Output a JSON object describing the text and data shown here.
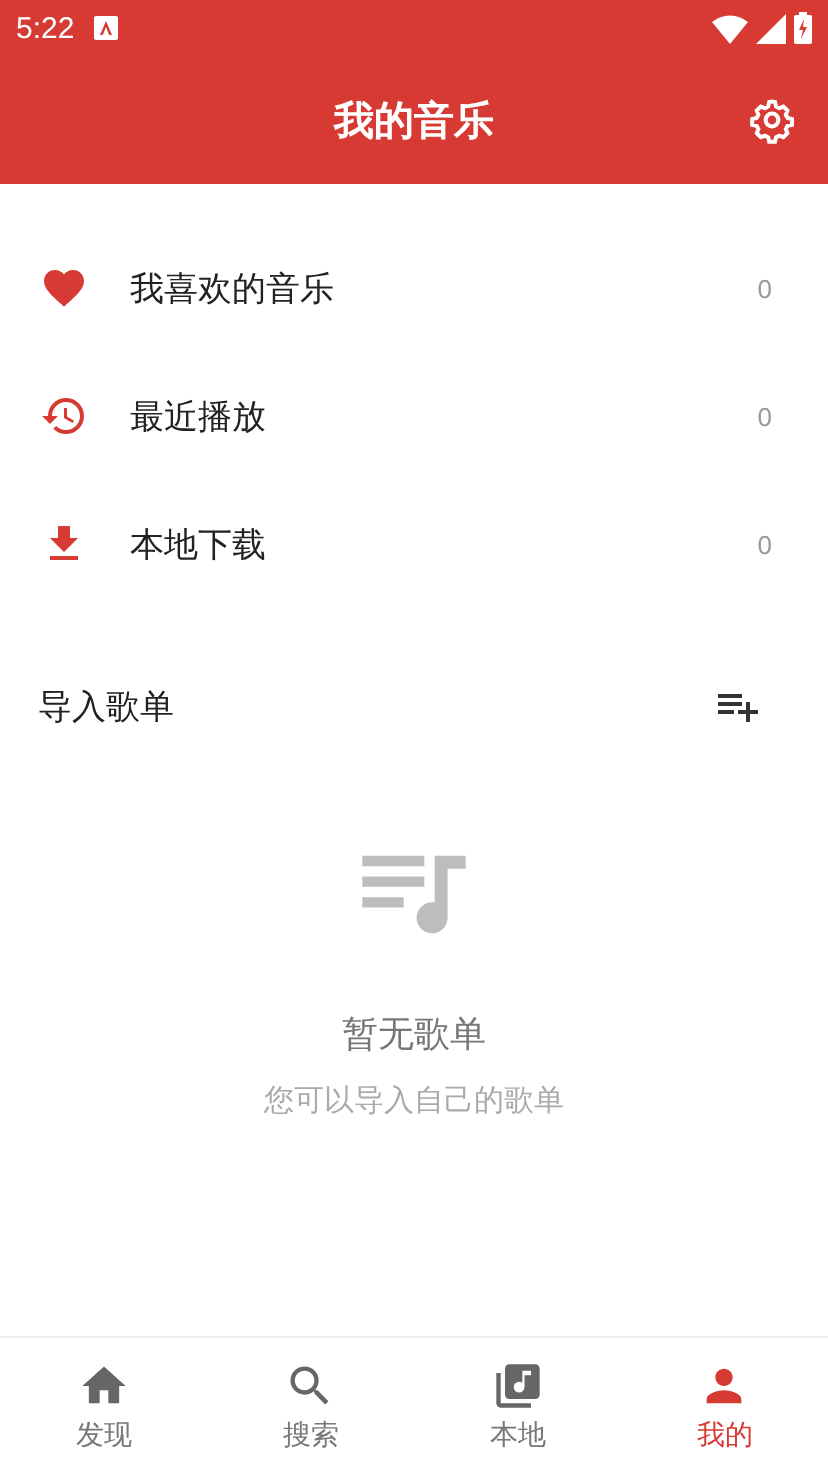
{
  "status_bar": {
    "time": "5:22"
  },
  "app_bar": {
    "title": "我的音乐"
  },
  "library": [
    {
      "label": "我喜欢的音乐",
      "count": "0"
    },
    {
      "label": "最近播放",
      "count": "0"
    },
    {
      "label": "本地下载",
      "count": "0"
    }
  ],
  "playlists": {
    "title": "导入歌单",
    "empty_title": "暂无歌单",
    "empty_hint": "您可以导入自己的歌单"
  },
  "bottom_nav": [
    {
      "label": "发现",
      "selected": false
    },
    {
      "label": "搜索",
      "selected": false
    },
    {
      "label": "本地",
      "selected": false
    },
    {
      "label": "我的",
      "selected": true
    }
  ]
}
